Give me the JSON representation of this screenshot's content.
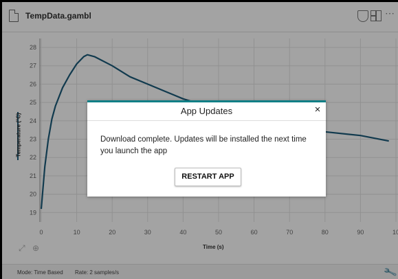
{
  "titlebar": {
    "file_name": "TempData.gambl"
  },
  "chart_data": {
    "type": "line",
    "xlabel": "Time (s)",
    "ylabel": "Temperature (°C)",
    "xlim": [
      0,
      100
    ],
    "ylim": [
      18.5,
      28.5
    ],
    "x_ticks": [
      "0",
      "10",
      "20",
      "30",
      "40",
      "50",
      "60",
      "70",
      "80",
      "90",
      "10"
    ],
    "y_ticks": [
      "28",
      "27",
      "26",
      "25",
      "24",
      "23",
      "22",
      "21",
      "20",
      "19"
    ],
    "series": [
      {
        "x": [
          0,
          1,
          2,
          3,
          4,
          6,
          8,
          10,
          12,
          13,
          15,
          20,
          25,
          30,
          35,
          40,
          45,
          50,
          60,
          70,
          80,
          90,
          98
        ],
        "y": [
          19.2,
          21.5,
          23.0,
          24.1,
          24.8,
          25.8,
          26.5,
          27.1,
          27.5,
          27.6,
          27.5,
          27.0,
          26.4,
          26.0,
          25.6,
          25.2,
          24.9,
          24.6,
          24.1,
          23.7,
          23.4,
          23.2,
          22.9
        ]
      }
    ]
  },
  "toolbar": {
    "autoscale_icon": "autoscale-icon",
    "zoom_icon": "zoom-icon"
  },
  "status": {
    "mode": "Mode: Time Based",
    "rate": "Rate: 2 samples/s"
  },
  "dialog": {
    "title": "App Updates",
    "close_label": "×",
    "message": "Download complete. Updates will be installed the next time you launch the app",
    "restart_label": "RESTART APP"
  },
  "colors": {
    "accent": "#0e7f86",
    "series": "#1b5b7a"
  }
}
